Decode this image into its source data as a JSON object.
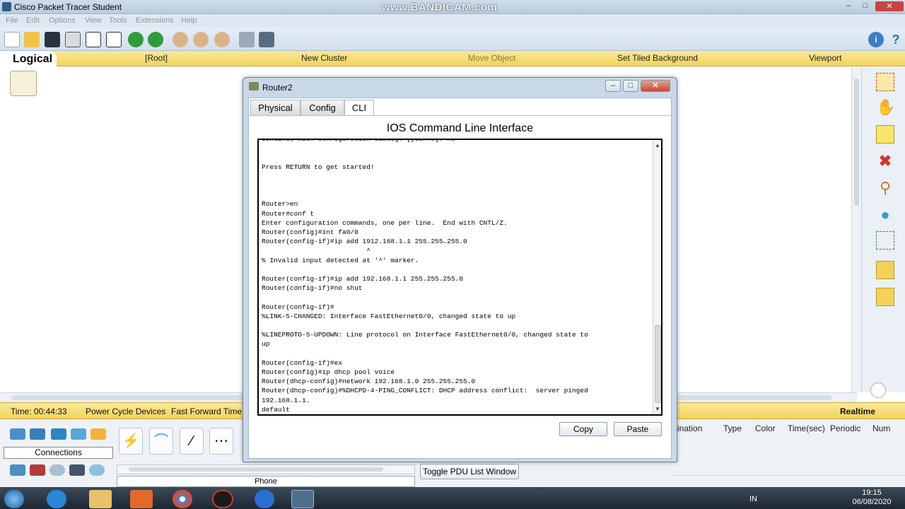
{
  "app": {
    "title": "Cisco Packet Tracer Student",
    "watermark": "www.BANDICAM.com",
    "window_controls": [
      "minimize",
      "maximize",
      "close"
    ]
  },
  "menu": [
    "File",
    "Edit",
    "Options",
    "View",
    "Tools",
    "Extensions",
    "Help"
  ],
  "toolbar_icons": [
    "new-icon",
    "open-icon",
    "save-icon",
    "print-icon",
    "activity-wizard-icon",
    "copy-icon",
    "paste-icon",
    "undo-icon",
    "redo-icon",
    "zoom-in-icon",
    "zoom-reset-icon",
    "zoom-out-icon",
    "palette-icon",
    "custom-device-icon",
    "info-icon",
    "help-icon"
  ],
  "logical_bar": {
    "tab": "Logical",
    "items": [
      "[Root]",
      "New Cluster",
      "Move Object",
      "Set Tiled Background",
      "Viewport"
    ]
  },
  "status_bar": {
    "time": "Time: 00:44:33",
    "power_cycle": "Power Cycle Devices",
    "fast_forward": "Fast Forward Time",
    "mode": "Realtime"
  },
  "device_panel": {
    "connections_label": "Connections",
    "selected_subtype": "Phone",
    "toggle_pdu": "Toggle PDU List Window",
    "pdu_columns": [
      "ination",
      "Type",
      "Color",
      "Time(sec)",
      "Periodic",
      "Num"
    ]
  },
  "router_window": {
    "title": "Router2",
    "tabs": [
      "Physical",
      "Config",
      "CLI"
    ],
    "active_tab": "CLI",
    "heading": "IOS Command Line Interface",
    "cli_output": "Continue with configuration dialog? [yes/no]: no\n\n\nPress RETURN to get started!\n\n\n\nRouter>en\nRouter#conf t\nEnter configuration commands, one per line.  End with CNTL/Z.\nRouter(config)#int fa0/0\nRouter(config-if)#ip add 1912.168.1.1 255.255.255.0\n                          ^\n% Invalid input detected at '^' marker.\n\nRouter(config-if)#ip add 192.168.1.1 255.255.255.0\nRouter(config-if)#no shut\n\nRouter(config-if)#\n%LINK-5-CHANGED: Interface FastEthernet0/0, changed state to up\n\n%LINEPROTO-5-UPDOWN: Line protocol on Interface FastEthernet0/0, changed state to\nup\n\nRouter(config-if)#ex\nRouter(config)#ip dhcp pool voice\nRouter(dhcp-config)#network 192.168.1.0 255.255.255.0\nRouter(dhcp-config)#%DHCPD-4-PING_CONFLICT: DHCP address conflict:  server pinged\n192.168.1.1.\ndefault",
    "copy_label": "Copy",
    "paste_label": "Paste"
  },
  "taskbar": {
    "lang": "IN",
    "time": "19:15",
    "date": "06/08/2020"
  }
}
